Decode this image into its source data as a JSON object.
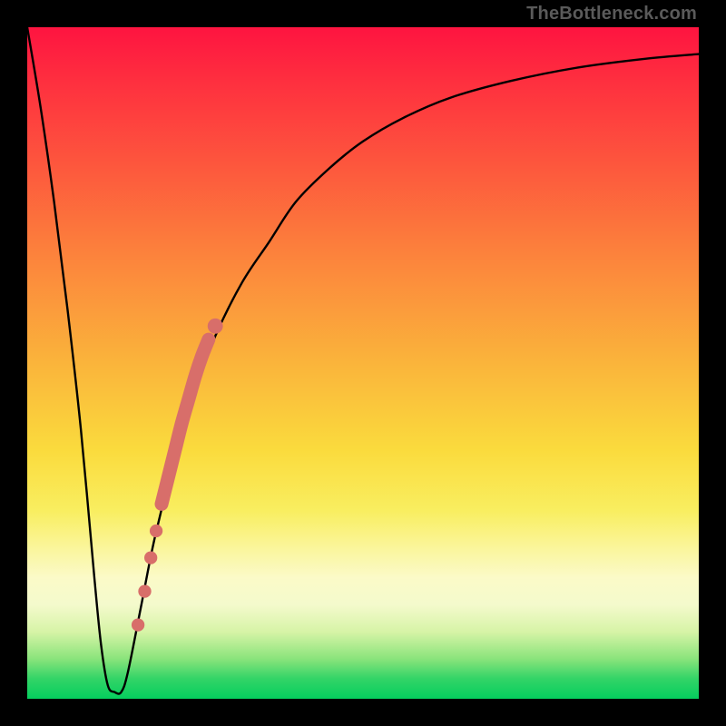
{
  "watermark": {
    "text": "TheBottleneck.com"
  },
  "chart_data": {
    "type": "line",
    "title": "",
    "xlabel": "",
    "ylabel": "",
    "xlim": [
      0,
      100
    ],
    "ylim": [
      0,
      100
    ],
    "series": [
      {
        "name": "bottleneck-curve",
        "x": [
          0,
          2,
          4,
          6,
          8,
          10,
          11,
          12,
          13,
          14,
          15,
          17,
          19,
          22,
          25,
          28,
          32,
          36,
          40,
          45,
          50,
          56,
          63,
          72,
          82,
          92,
          100
        ],
        "y": [
          100,
          88,
          74,
          58,
          40,
          18,
          8,
          2,
          1,
          1,
          4,
          14,
          24,
          36,
          46,
          54,
          62,
          68,
          74,
          79,
          83,
          86.5,
          89.5,
          92,
          94,
          95.3,
          96
        ]
      }
    ],
    "highlight_points": {
      "name": "highlighted-segment",
      "color": "#d86e6a",
      "points": [
        {
          "x": 16.5,
          "y": 11,
          "r": 1.1
        },
        {
          "x": 17.5,
          "y": 16,
          "r": 1.1
        },
        {
          "x": 18.4,
          "y": 21,
          "r": 1.1
        },
        {
          "x": 19.2,
          "y": 25,
          "r": 1.1
        },
        {
          "x": 20.0,
          "y": 29,
          "r": 1.5
        },
        {
          "x": 21.0,
          "y": 33,
          "r": 1.6
        },
        {
          "x": 22.0,
          "y": 37,
          "r": 1.7
        },
        {
          "x": 23.0,
          "y": 41,
          "r": 1.7
        },
        {
          "x": 24.0,
          "y": 44.5,
          "r": 1.7
        },
        {
          "x": 25.0,
          "y": 48,
          "r": 1.7
        },
        {
          "x": 26.0,
          "y": 51,
          "r": 1.7
        },
        {
          "x": 27.0,
          "y": 53.5,
          "r": 1.6
        },
        {
          "x": 28.0,
          "y": 55.5,
          "r": 1.3
        }
      ]
    },
    "colors": {
      "curve": "#000000",
      "highlight": "#d86e6a",
      "background_top": "#fe1440",
      "background_bottom": "#05ce5e",
      "frame": "#000000"
    }
  }
}
